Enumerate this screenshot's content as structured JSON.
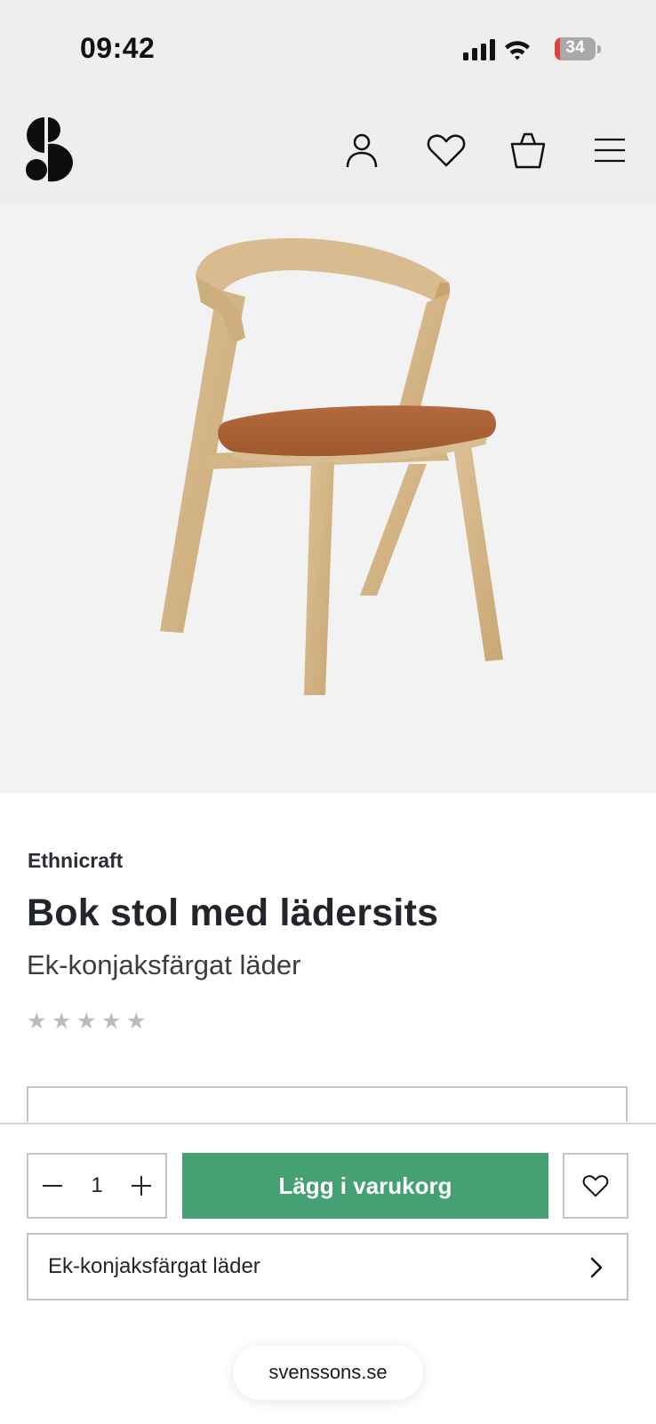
{
  "status_bar": {
    "time": "09:42",
    "battery_level": "34",
    "icons": [
      "signal-icon",
      "wifi-icon",
      "battery-icon"
    ]
  },
  "header": {
    "logo": "svenssons-logo",
    "icons": [
      "account-icon",
      "heart-icon",
      "shopping-bag-icon",
      "menu-icon"
    ]
  },
  "product": {
    "image": "oak chair with cognac leather seat",
    "brand": "Ethnicraft",
    "title": "Bok stol med lädersits",
    "variant_subtitle": "Ek-konjaksfärgat läder",
    "rating_stars": 5,
    "rating_filled": 0
  },
  "purchase_bar": {
    "quantity": "1",
    "add_to_cart_label": "Lägg i varukorg",
    "selected_variant": "Ek-konjaksfärgat läder"
  },
  "browser": {
    "url": "svenssons.se"
  },
  "colors": {
    "header_bg": "#efeeed",
    "cta_green": "#45a074",
    "border": "#c7c4bd",
    "star_empty": "#b9bbbf"
  }
}
